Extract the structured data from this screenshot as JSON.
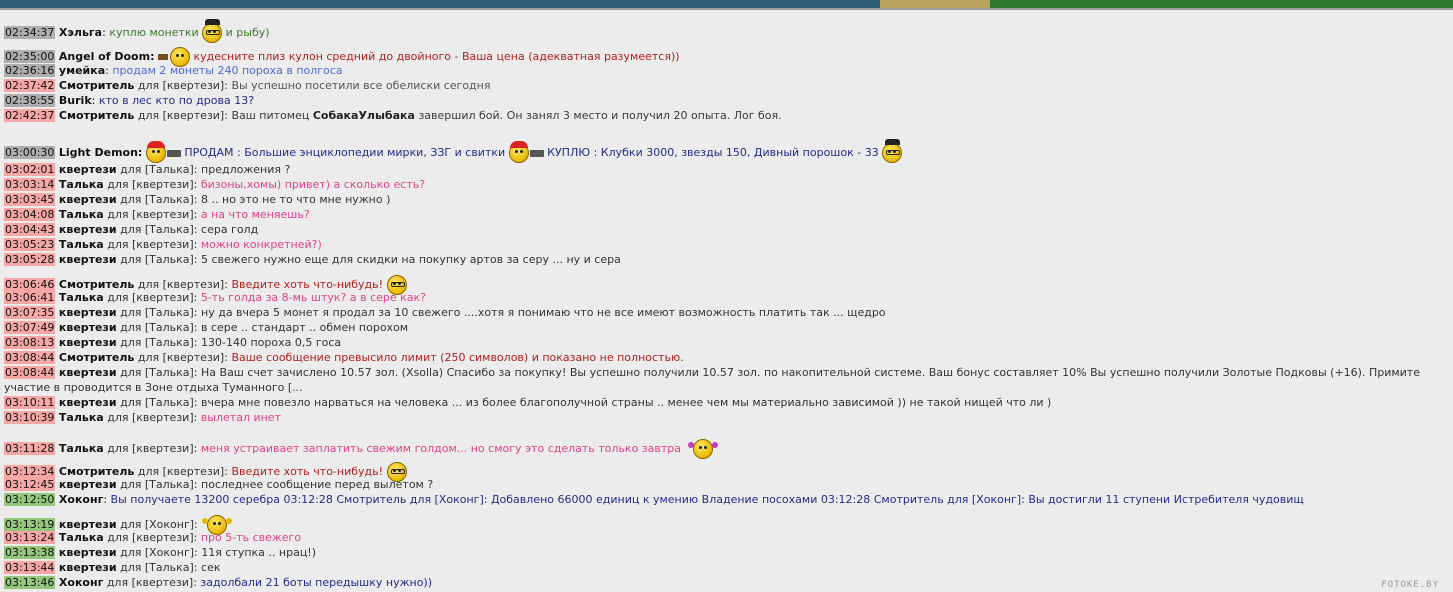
{
  "watermark": "FOTOKE.BY",
  "lines": {
    "l1": {
      "time": "02:34:37",
      "nick": "Хэльга",
      "sep": ":",
      "msg": "куплю монетки",
      "msg2": "и рыбу)"
    },
    "l2": {
      "time": "02:35:00",
      "nick": "Angel of Doom:",
      "msg": "кудесните плиз кулон средний до двойного - Ваша цена (адекватная разумеется))"
    },
    "l3": {
      "time": "02:36:16",
      "nick": "умейка",
      "sep": ":",
      "msg": "продам 2 монеты 240 пороха в полгоса"
    },
    "l4": {
      "time": "02:37:42",
      "nick": "Смотритель",
      "to": "для [квертези]:",
      "msg": "Вы успешно посетили все обелиски сегодня"
    },
    "l5": {
      "time": "02:38:55",
      "nick": "Burik",
      "sep": ":",
      "msg": "кто в лес кто по дрова 13?"
    },
    "l6": {
      "time": "02:42:37",
      "nick": "Смотритель",
      "to": "для [квертези]:",
      "msg": "Ваш питомец",
      "msg_bold": "СобакаУлыбака",
      "msg2": "завершил бой. Он занял 3 место и получил 20 опыта. Лог боя."
    },
    "l7": {
      "time": "03:00:30",
      "nick": "Light Demon:",
      "msg": "ПРОДАМ : Большие энциклопедии мирки, ЗЗГ и свитки",
      "msg2": "КУПЛЮ : Клубки 3000, звезды 150, Дивный порошок - 33"
    },
    "l8": {
      "time": "03:02:01",
      "nick": "квертези",
      "to": "для [Талька]:",
      "msg": "предложения ?"
    },
    "l9": {
      "time": "03:03:14",
      "nick": "Талька",
      "to": "для [квертези]:",
      "msg": "бизоны,хомы) привет) а сколько есть?"
    },
    "l10": {
      "time": "03:03:45",
      "nick": "квертези",
      "to": "для [Талька]:",
      "msg": "8 .. но это не то что мне нужно )"
    },
    "l11": {
      "time": "03:04:08",
      "nick": "Талька",
      "to": "для [квертези]:",
      "msg": "а на что меняешь?"
    },
    "l12": {
      "time": "03:04:43",
      "nick": "квертези",
      "to": "для [Талька]:",
      "msg": "сера голд"
    },
    "l13": {
      "time": "03:05:23",
      "nick": "Талька",
      "to": "для [квертези]:",
      "msg": "можно конкретней?)"
    },
    "l14": {
      "time": "03:05:28",
      "nick": "квертези",
      "to": "для [Талька]:",
      "msg": "5 свежего нужно еще для скидки на покупку артов за серу ... ну и сера"
    },
    "l15": {
      "time": "03:06:46",
      "nick": "Смотритель",
      "to": "для [квертези]:",
      "msg": "Введите хоть что-нибудь!"
    },
    "l16": {
      "time": "03:06:41",
      "nick": "Талька",
      "to": "для [квертези]:",
      "msg": "5-ть голда за 8-мь штук? а в сере как?"
    },
    "l17": {
      "time": "03:07:35",
      "nick": "квертези",
      "to": "для [Талька]:",
      "msg": "ну да вчера 5 монет я продал за 10 свежего ....хотя я понимаю что не все имеют возможность платить так ... щедро"
    },
    "l18": {
      "time": "03:07:49",
      "nick": "квертези",
      "to": "для [Талька]:",
      "msg": "в сере .. стандарт .. обмен порохом"
    },
    "l19": {
      "time": "03:08:13",
      "nick": "квертези",
      "to": "для [Талька]:",
      "msg": "130-140 пороха 0,5 госа"
    },
    "l20": {
      "time": "03:08:44",
      "nick": "Смотритель",
      "to": "для [квертези]:",
      "msg": "Ваше сообщение превысило лимит (250 символов) и показано не полностью."
    },
    "l21": {
      "time": "03:08:44",
      "nick": "квертези",
      "to": "для [Талька]:",
      "msg": "На Ваш счет зачислено 10.57 зол. (Xsolla) Спасибо за покупку! Вы успешно получили 10.57 зол. по накопительной системе. Ваш бонус составляет 10% Вы успешно получили Золотые Подковы (+16). Примите участие в",
      "msg2": "проводится в Зоне отдыха Туманного [..."
    },
    "l22": {
      "time": "03:10:11",
      "nick": "квертези",
      "to": "для [Талька]:",
      "msg": "вчера мне повезло нарваться на человека ... из более благополучной страны .. менее чем мы материально зависимой )) не такой нищей что ли )"
    },
    "l23": {
      "time": "03:10:39",
      "nick": "Талька",
      "to": "для [квертези]:",
      "msg": "вылетал инет"
    },
    "l24": {
      "time": "03:11:28",
      "nick": "Талька",
      "to": "для [квертези]:",
      "msg": "меня устраивает заплатить свежим голдом... но смогу это сделать только завтра"
    },
    "l25": {
      "time": "03:12:34",
      "nick": "Смотритель",
      "to": "для [квертези]:",
      "msg": "Введите хоть что-нибудь!"
    },
    "l26": {
      "time": "03:12:45",
      "nick": "квертези",
      "to": "для [Талька]:",
      "msg": "последнее сообщение перед вылетом ?"
    },
    "l27": {
      "time": "03:12:50",
      "nick": "Хоконг",
      "sep": ":",
      "msg": "Вы получаете 13200 серебра 03:12:28 Смотритель для [Хоконг]: Добавлено 66000 единиц к умению Владение посохами 03:12:28 Смотритель для [Хоконг]: Вы достигли 11 ступени Истребителя чудовищ"
    },
    "l28": {
      "time": "03:13:19",
      "nick": "квертези",
      "to": "для [Хоконг]:",
      "msg": ""
    },
    "l29": {
      "time": "03:13:24",
      "nick": "Талька",
      "to": "для [квертези]:",
      "msg": "про 5-ть свежего"
    },
    "l30": {
      "time": "03:13:38",
      "nick": "квертези",
      "to": "для [Хоконг]:",
      "msg": "11я ступка .. нрац!)"
    },
    "l31": {
      "time": "03:13:44",
      "nick": "квертези",
      "to": "для [Талька]:",
      "msg": "сек"
    },
    "l32": {
      "time": "03:13:46",
      "nick": "Хоконг",
      "to": "для [квертези]:",
      "msg": "задолбали 21 боты передышку нужно))"
    }
  }
}
